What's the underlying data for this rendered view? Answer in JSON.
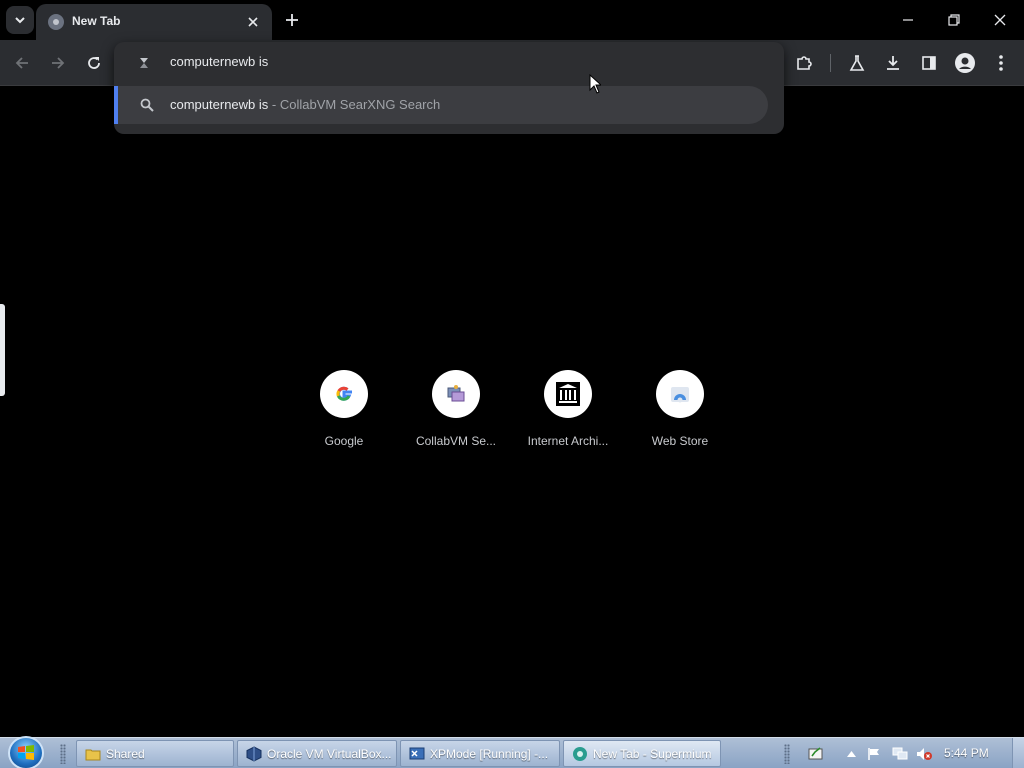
{
  "browser": {
    "tab": {
      "title": "New Tab"
    },
    "omnibox": {
      "input_value": "computernewb is",
      "suggestion": {
        "query": "computernewb is",
        "separator": " - ",
        "provider": "CollabVM SearXNG Search"
      }
    },
    "shortcuts": [
      {
        "label": "Google",
        "icon": "google-icon"
      },
      {
        "label": "CollabVM Se...",
        "icon": "collabvm-icon"
      },
      {
        "label": "Internet Archi...",
        "icon": "internet-archive-icon"
      },
      {
        "label": "Web Store",
        "icon": "web-store-icon"
      }
    ]
  },
  "taskbar": {
    "tasks": [
      {
        "label": "Shared",
        "icon": "folder-icon"
      },
      {
        "label": "Oracle VM VirtualBox...",
        "icon": "virtualbox-icon"
      },
      {
        "label": "XPMode [Running] -...",
        "icon": "xpmode-icon"
      },
      {
        "label": "New Tab - Supermium",
        "icon": "supermium-icon"
      }
    ],
    "clock": "5:44 PM"
  },
  "colors": {
    "accent": "#4f7ff0",
    "toolbar_bg": "#2b2d31",
    "page_bg": "#000000"
  }
}
